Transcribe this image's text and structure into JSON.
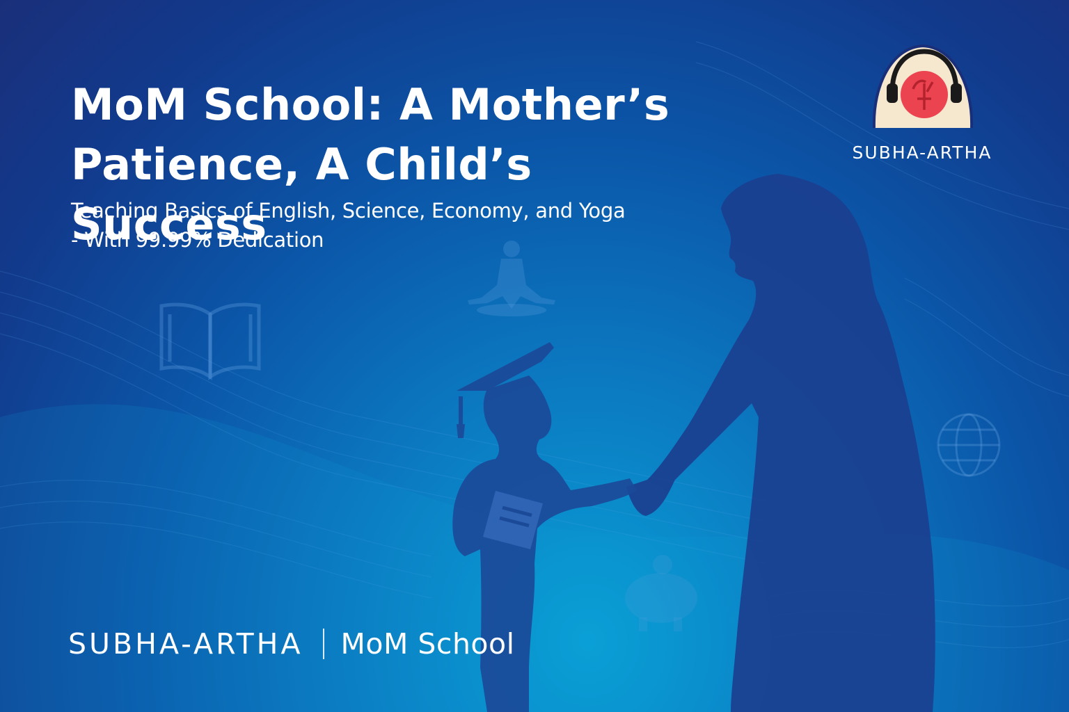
{
  "title_line1": "MoM School: A Mother’s",
  "title_line2": "Patience, A Child’s Success",
  "subtitle_line1": "Teaching Basics of English, Science, Economy, and Yoga",
  "subtitle_line2": "- With 99.99% Dedication",
  "logo_text": "SUBHA-ARTHA",
  "footer": {
    "brand": "SUBHA-ARTHA",
    "school": "MoM School"
  },
  "icons": [
    "open-book-icon",
    "meditation-icon",
    "globe-icon",
    "piggy-bank-icon",
    "graduation-cap-icon",
    "headphones-icon"
  ],
  "colors": {
    "background_dark": "#1a2f7a",
    "background_light": "#0aa0d6",
    "silhouette": "#1b3f8f",
    "logo_red": "#e8404a",
    "logo_cream": "#f6e7cf",
    "text": "#ffffff"
  }
}
